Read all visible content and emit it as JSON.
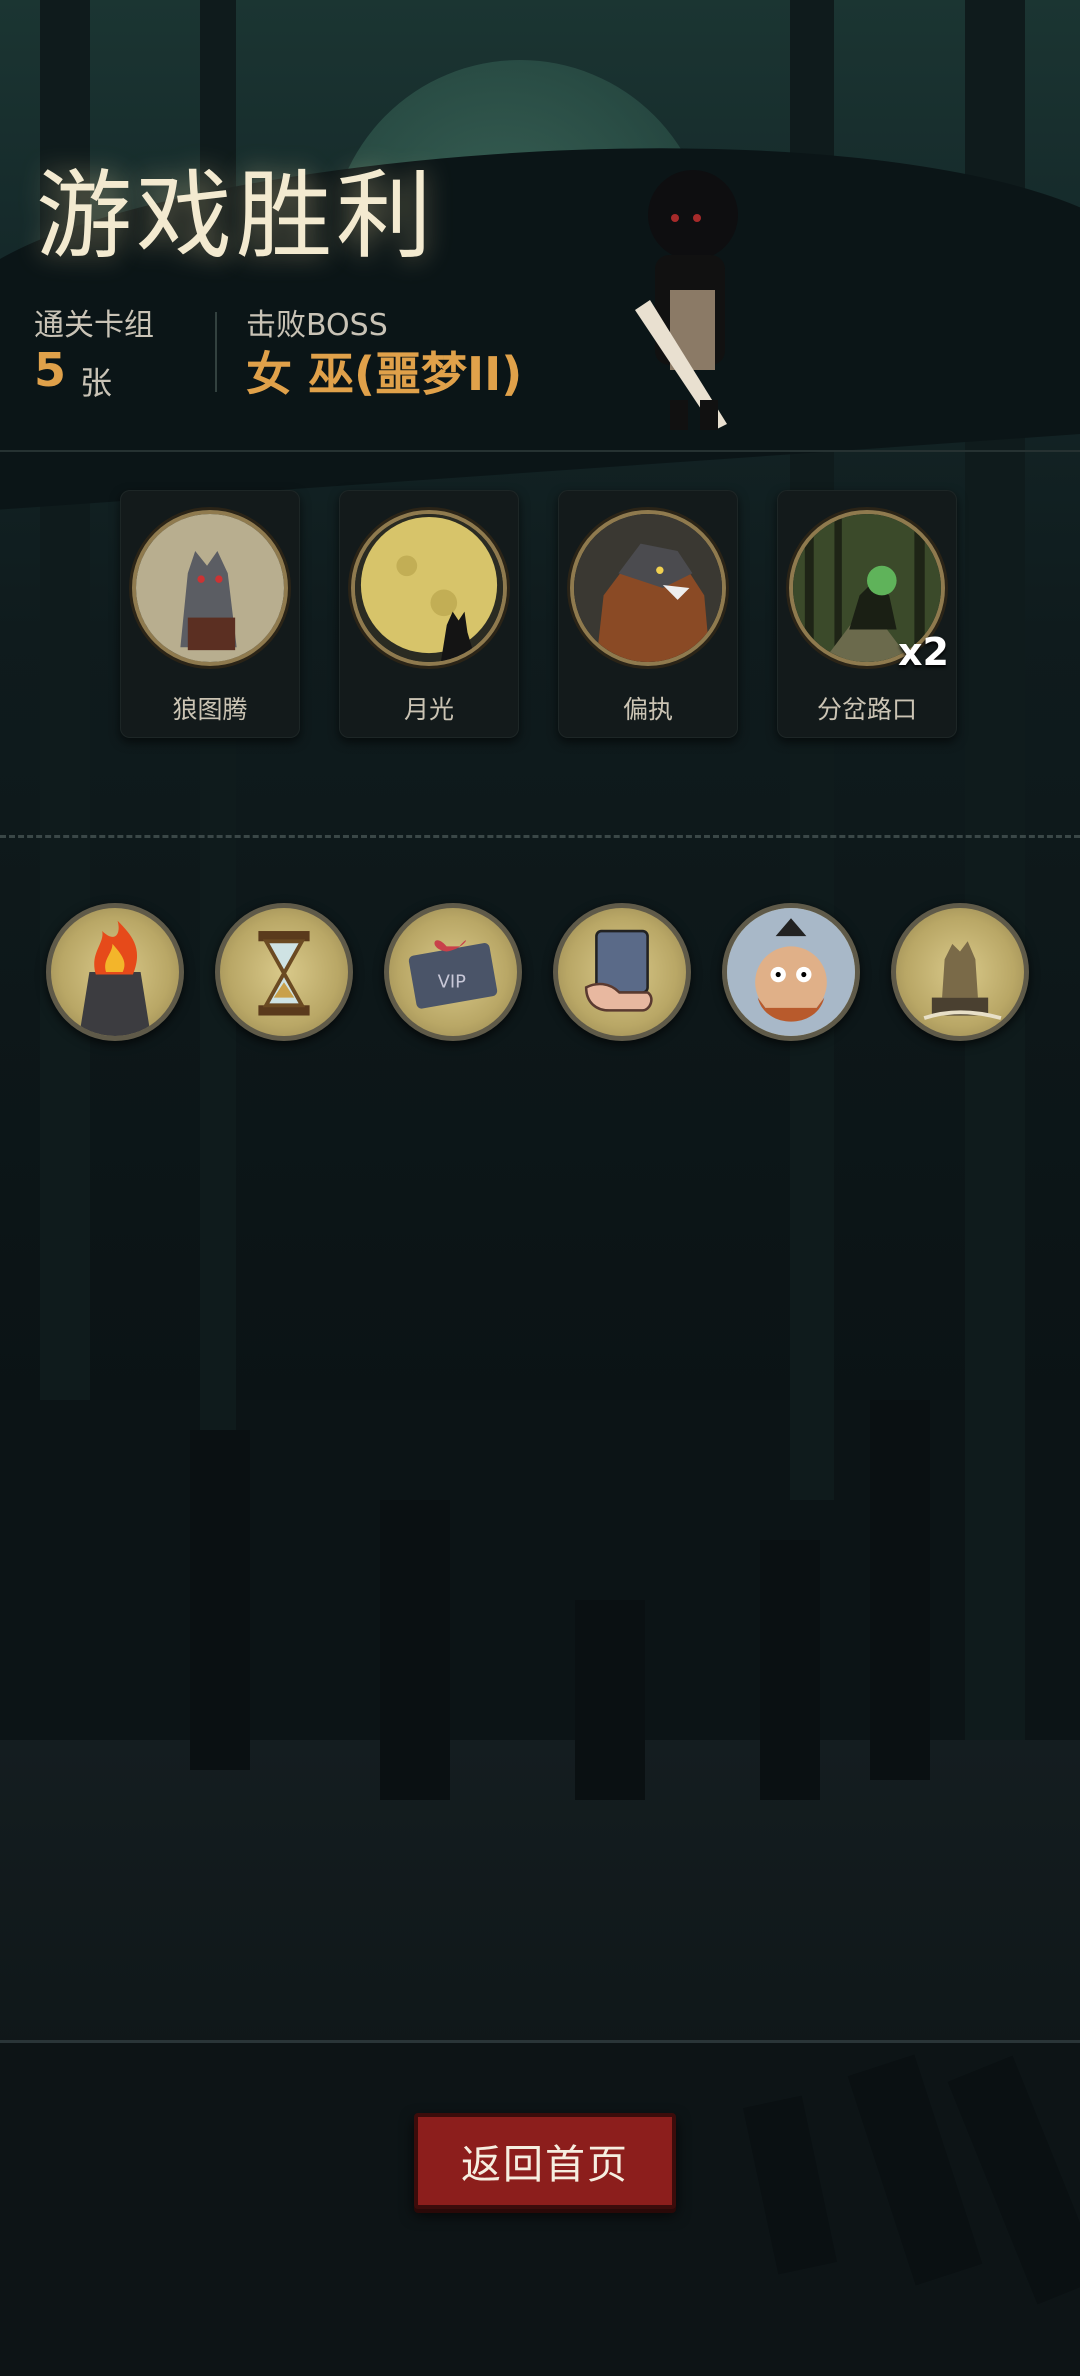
{
  "header": {
    "title": "游戏胜利",
    "deck_label": "通关卡组",
    "deck_count": "5",
    "deck_unit": "张",
    "boss_label": "击败BOSS",
    "boss_name": "女 巫(噩梦II)"
  },
  "cards": [
    {
      "label": "狼图腾",
      "icon": "wolf-totem-icon"
    },
    {
      "label": "月光",
      "icon": "moonlight-icon"
    },
    {
      "label": "偏执",
      "icon": "werewolf-icon"
    },
    {
      "label": "分岔路口",
      "icon": "forest-crossroad-icon",
      "count": "x2"
    }
  ],
  "relics": [
    {
      "icon": "fire-brazier-icon"
    },
    {
      "icon": "hourglass-icon"
    },
    {
      "icon": "vip-ticket-icon"
    },
    {
      "icon": "hand-card-icon"
    },
    {
      "icon": "scared-man-icon"
    },
    {
      "icon": "ruined-statue-icon"
    }
  ],
  "actions": {
    "home_button": "返回首页"
  },
  "colors": {
    "accent_gold": "#e0a14a",
    "title_glow": "#f3ead0",
    "button_red": "#8c1e1c"
  }
}
